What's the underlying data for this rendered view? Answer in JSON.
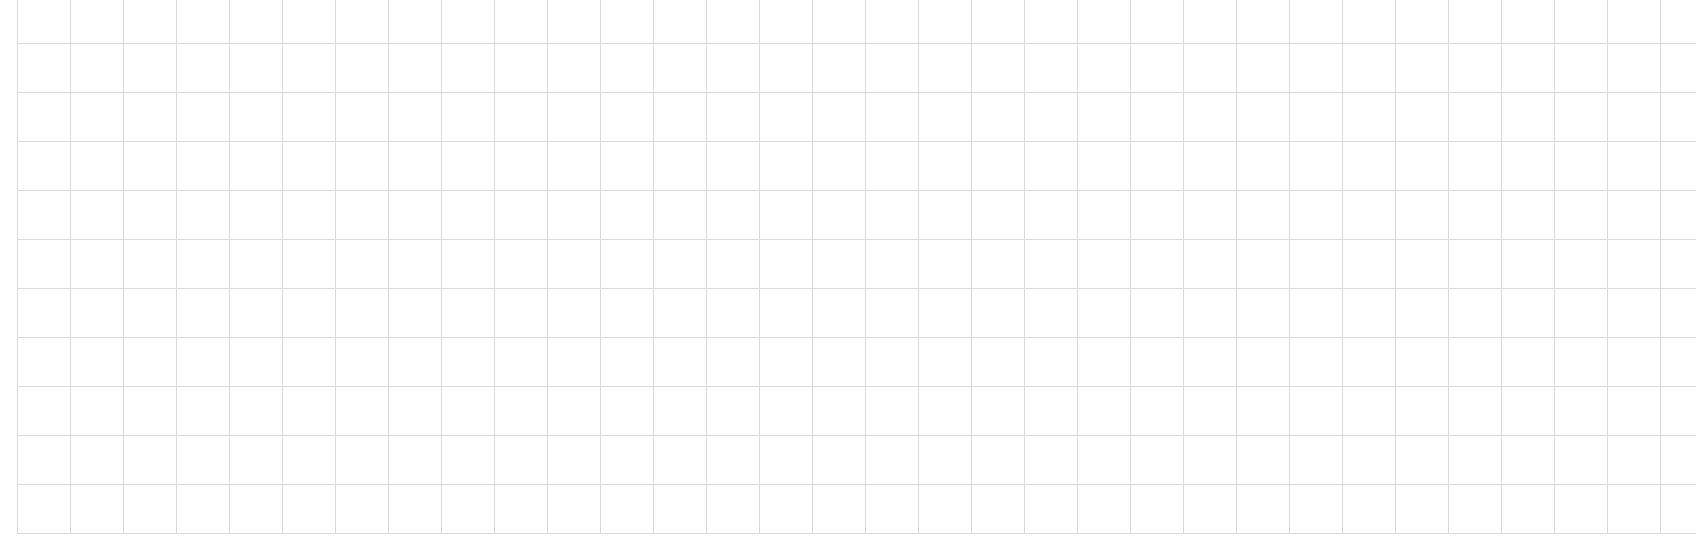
{
  "grid": {
    "rows": 11,
    "columns": 32,
    "cells": []
  },
  "colors": {
    "gridline": "#dadada",
    "background": "#ffffff"
  }
}
